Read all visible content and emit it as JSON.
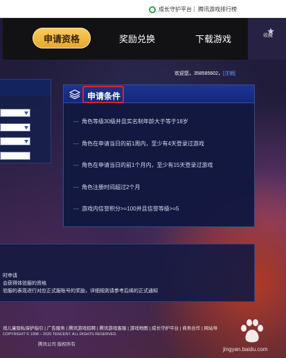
{
  "topbar": {
    "guard_label": "成长守护平台",
    "rank_label": "腾讯游戏排行榜"
  },
  "nav": {
    "tabs": [
      {
        "label": "申请资格",
        "active": true
      },
      {
        "label": "奖励兑换",
        "active": false
      },
      {
        "label": "下载游戏",
        "active": false
      }
    ],
    "favorite_label": "收藏"
  },
  "welcome": {
    "text": "欢迎您，358585602，",
    "logout": "[注销]"
  },
  "conditions": {
    "title": "申请条件",
    "items": [
      "角色等级30级并且实名制年龄大于等于18岁",
      "角色在申请当日的前1周内，至少有4天登录过游戏",
      "角色在申请当日的前1个月内，至少有15天登录过游戏",
      "角色注册时间超过2个月",
      "游戏内信誉积分>=100并且信誉等级>=5"
    ]
  },
  "notice": {
    "lines": [
      "时申请",
      "会获得体验服的资格",
      "验服的表现进行对应正式服账号的奖励，详细规则请参考后续的正式通知"
    ]
  },
  "footer": {
    "links": "戏儿童隐私保护指引 | 广告服务 | 腾讯游戏招聘 | 腾讯游戏客服 | 游戏地图 | 成长守护平台 | 商务合作 | 网站导",
    "copyright": "COPYRIGHT © 1998 – 2020 TENCENT. ALL RIGHTS RESERVED.",
    "rights": "腾讯公司 版权所有"
  },
  "watermark": {
    "site": "jingyan.baidu.com"
  },
  "colors": {
    "accent_gold": "#f0b844",
    "panel_blue": "#14287a",
    "highlight_red": "#e4202a",
    "guard_green": "#2ca44a"
  }
}
